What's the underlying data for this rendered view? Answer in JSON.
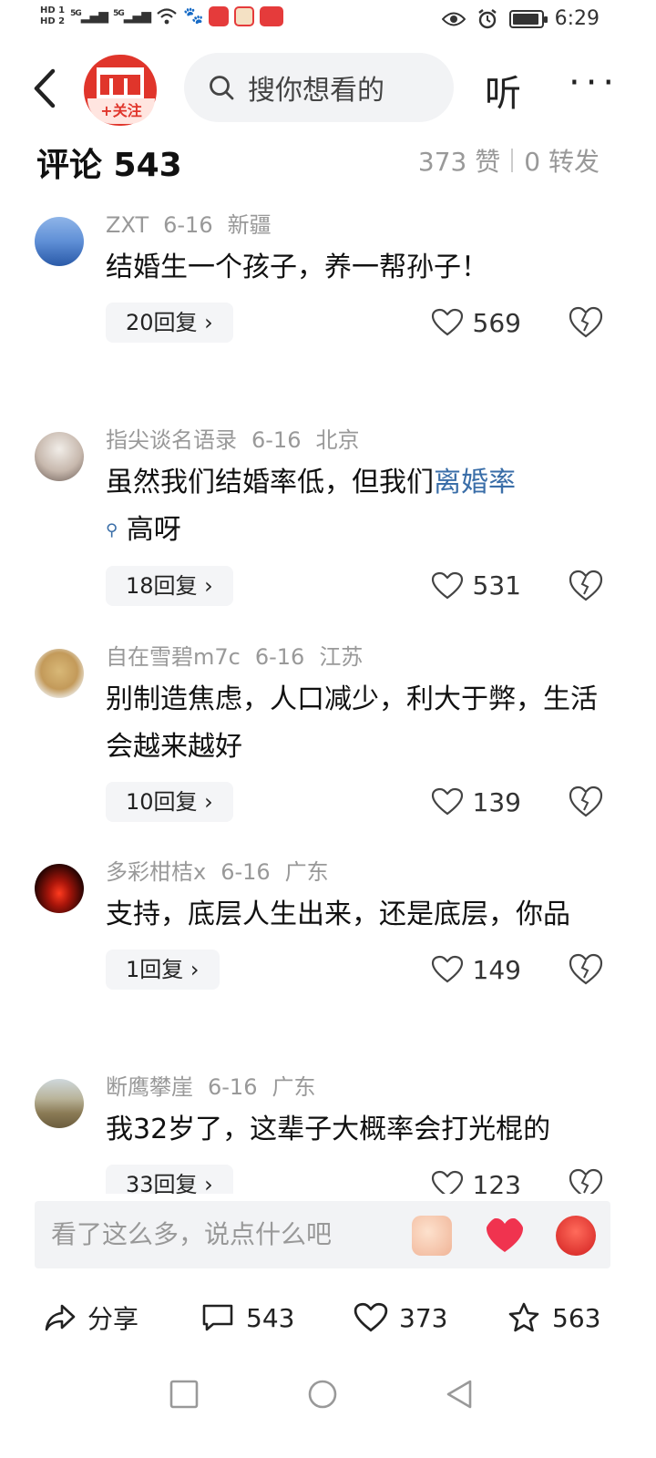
{
  "status_bar": {
    "hd1": "HD 1",
    "hd2": "HD 2",
    "net1": "5G",
    "net2": "5G",
    "time": "6:29",
    "icons": [
      "wifi-icon",
      "baidu-icon",
      "red-app-icon",
      "weibo-icon",
      "toutiao-icon",
      "eye-icon",
      "alarm-icon",
      "battery-icon"
    ]
  },
  "header": {
    "follow_label": "+关注",
    "search_placeholder": "搜你想看的",
    "listen_label": "听",
    "more_label": "···"
  },
  "comments_header": {
    "title": "评论 543",
    "likes": "373 赞",
    "reposts": "0 转发"
  },
  "comments": [
    {
      "user": "ZXT",
      "date": "6-16",
      "location": "新疆",
      "text": "结婚生一个孩子，养一帮孙子！",
      "replies": "20回复",
      "likes": "569"
    },
    {
      "user": "指尖谈名语录",
      "date": "6-16",
      "location": "北京",
      "text_before": "虽然我们结婚率低，但我们",
      "link": "离婚率",
      "text_after": "高呀",
      "replies": "18回复",
      "likes": "531"
    },
    {
      "user": "自在雪碧m7c",
      "date": "6-16",
      "location": "江苏",
      "text": "别制造焦虑，人口减少，利大于弊，生活会越来越好",
      "replies": "10回复",
      "likes": "139"
    },
    {
      "user": "多彩柑桔x",
      "date": "6-16",
      "location": "广东",
      "text": "支持，底层人生出来，还是底层，你品",
      "replies": "1回复",
      "likes": "149"
    },
    {
      "user": "断鹰攀崖",
      "date": "6-16",
      "location": "广东",
      "text": "我32岁了，这辈子大概率会打光棍的",
      "replies": "33回复",
      "likes": "123"
    }
  ],
  "input": {
    "placeholder": "看了这么多，说点什么吧"
  },
  "bottom_bar": {
    "share": "分享",
    "comments": "543",
    "likes": "373",
    "favorites": "563"
  },
  "colors": {
    "brand_red": "#e0352b",
    "link_blue": "#3a6ea8",
    "muted": "#999999"
  }
}
